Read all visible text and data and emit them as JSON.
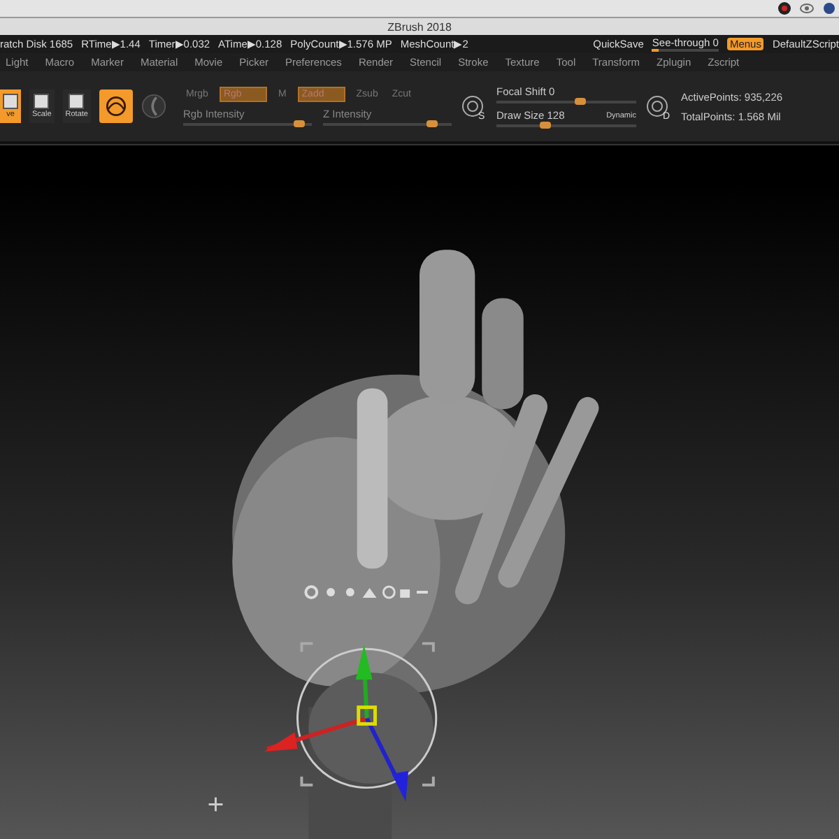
{
  "window": {
    "title": "ZBrush 2018"
  },
  "status_bar": {
    "items": [
      "ratch Disk 1685",
      "RTime▶1.44",
      "Timer▶0.032",
      "ATime▶0.128",
      "PolyCount▶1.576 MP",
      "MeshCount▶2"
    ],
    "quicksave": "QuickSave",
    "see_through": {
      "label": "See-through",
      "value": "0",
      "level": 0.1
    },
    "menus": {
      "label": "Menus",
      "on": true
    },
    "script": "DefaultZScript"
  },
  "menu_bar": [
    "Light",
    "Macro",
    "Marker",
    "Material",
    "Movie",
    "Picker",
    "Preferences",
    "Render",
    "Stencil",
    "Stroke",
    "Texture",
    "Tool",
    "Transform",
    "Zplugin",
    "Zscript"
  ],
  "shelf": {
    "tools": [
      {
        "label": "ve",
        "selected": true
      },
      {
        "label": "Scale",
        "selected": false
      },
      {
        "label": "Rotate",
        "selected": false
      }
    ],
    "toggles": [
      {
        "label": "Mrgb",
        "on": false
      },
      {
        "label": "Rgb",
        "on": true
      },
      {
        "label": "M",
        "on": false
      },
      {
        "label": "Zadd",
        "on": true
      },
      {
        "label": "Zsub",
        "on": false
      },
      {
        "label": "Zcut",
        "on": false
      }
    ],
    "intensity": [
      {
        "label": "Rgb Intensity",
        "level": 0.9
      },
      {
        "label": "Z Intensity",
        "level": 0.85
      }
    ],
    "brush": [
      {
        "label": "Focal Shift",
        "value": "0",
        "level": 0.6
      },
      {
        "label": "Draw Size",
        "value": "128",
        "level": 0.35
      }
    ],
    "dynamic": "Dynamic",
    "brush_icon_letters": [
      "S",
      "D"
    ],
    "points": [
      {
        "label": "ActivePoints:",
        "value": "935,226"
      },
      {
        "label": "TotalPoints:",
        "value": "1.568 Mil"
      }
    ]
  }
}
